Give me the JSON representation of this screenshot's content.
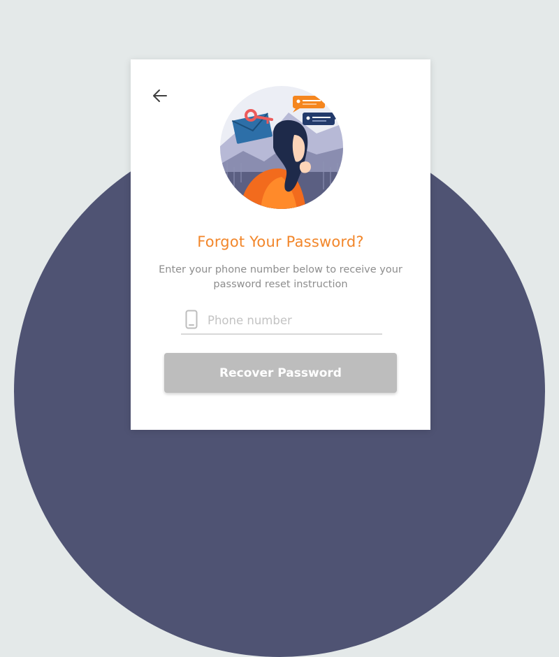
{
  "title": "Forgot Your Password?",
  "subtitle": "Enter your phone number below to receive your password reset instruction",
  "phone_input": {
    "placeholder": "Phone number",
    "value": ""
  },
  "recover_button": {
    "label": "Recover Password"
  },
  "icons": {
    "back": "arrow-left-icon",
    "phone": "smartphone-icon"
  },
  "colors": {
    "background": "#e4e9e9",
    "circle": "#4f5373",
    "card": "#ffffff",
    "accent": "#f2862a",
    "subtitle_text": "#8d8d8d",
    "button_disabled": "#bdbdbd"
  }
}
